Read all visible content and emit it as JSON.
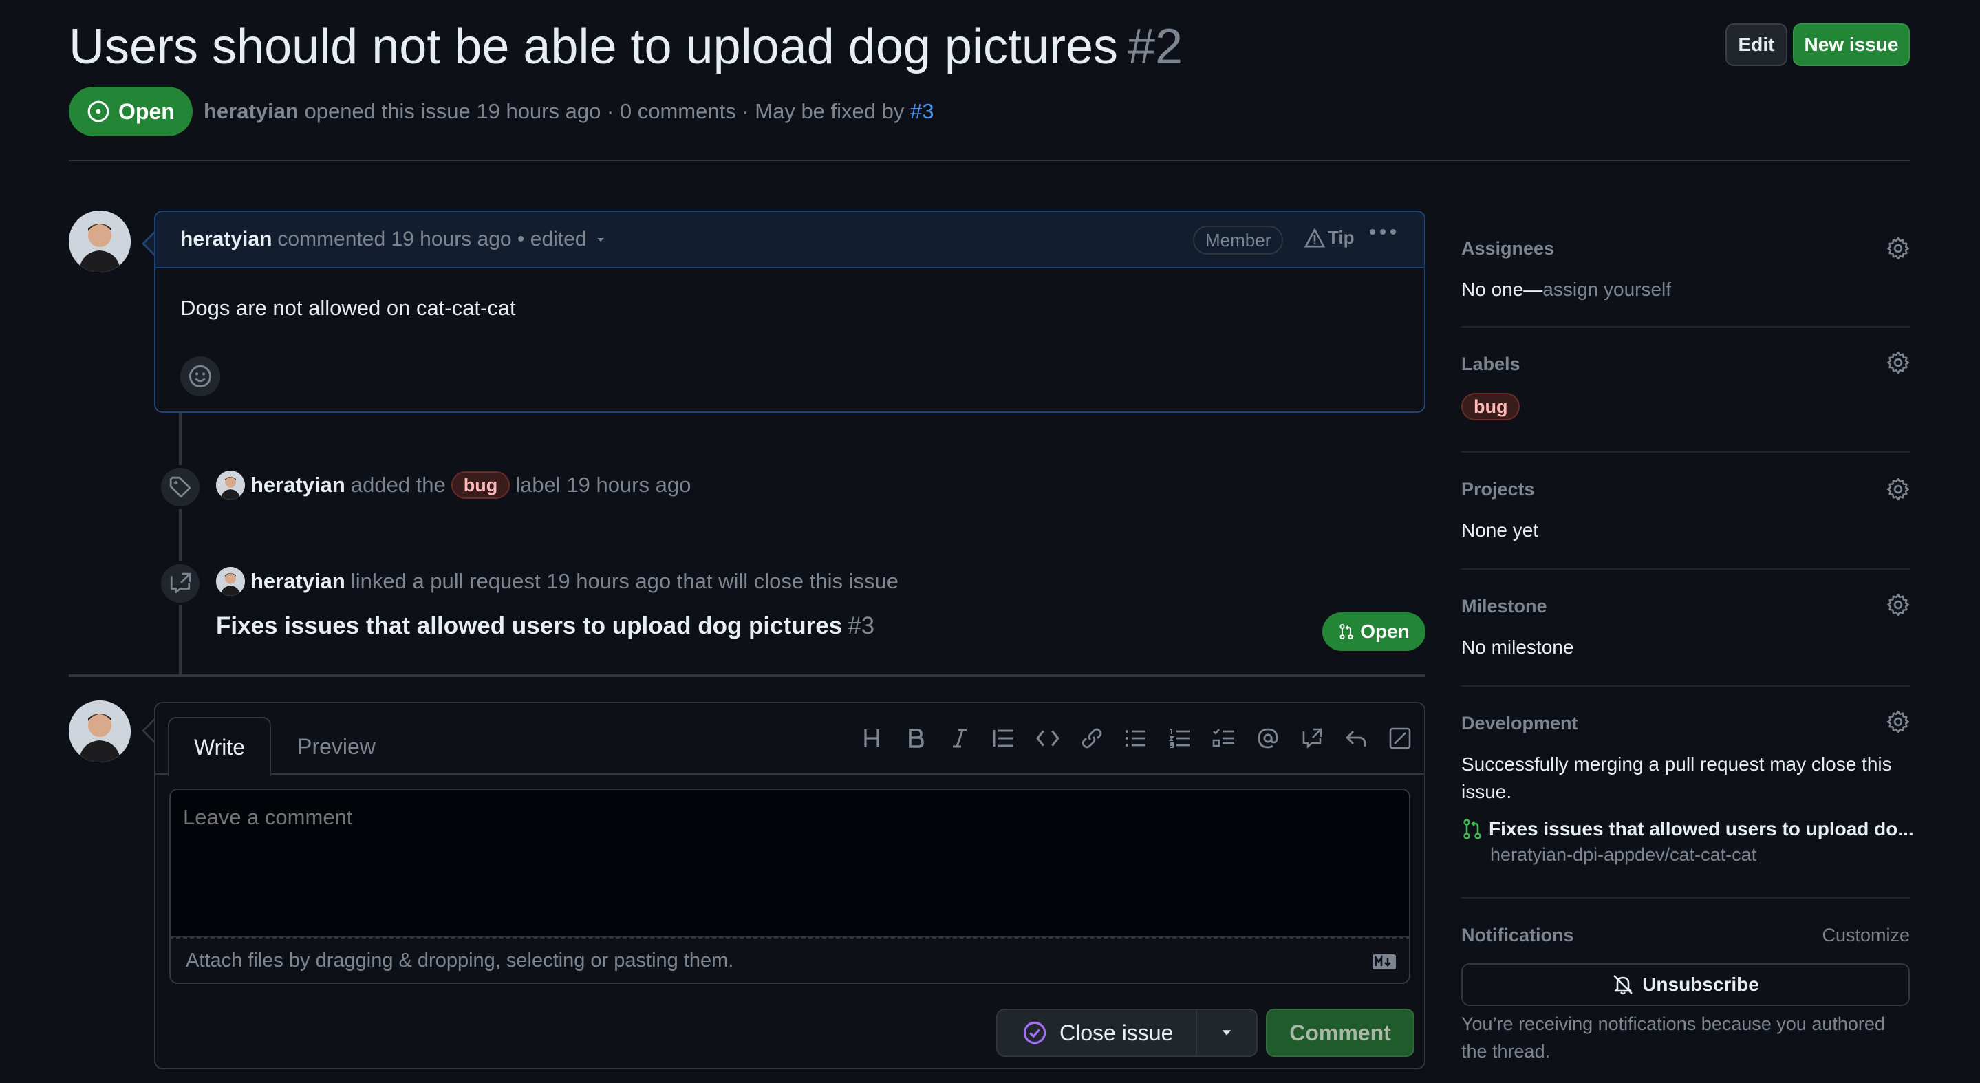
{
  "issue": {
    "title": "Users should not be able to upload dog pictures",
    "number": "#2",
    "state": "Open",
    "author": "heratyian",
    "opened_text": "opened this issue 19 hours ago · 0 comments · May be fixed by",
    "fixed_by": "#3"
  },
  "header": {
    "edit_label": "Edit",
    "new_issue_label": "New issue"
  },
  "comment": {
    "author": "heratyian",
    "meta": "commented 19 hours ago • edited",
    "badge": "Member",
    "tip": "Tip",
    "body": "Dogs are not allowed on cat-cat-cat"
  },
  "timeline": {
    "label_event": {
      "actor": "heratyian",
      "pre": "added the",
      "label": "bug",
      "post": "label 19 hours ago"
    },
    "link_event": {
      "actor": "heratyian",
      "text": "linked a pull request 19 hours ago that will close this issue",
      "pr_title": "Fixes issues that allowed users to upload dog pictures",
      "pr_number": "#3",
      "pr_state": "Open"
    }
  },
  "editor": {
    "tab_write": "Write",
    "tab_preview": "Preview",
    "placeholder": "Leave a comment",
    "attach_text": "Attach files by dragging & dropping, selecting or pasting them.",
    "close_label": "Close issue",
    "comment_label": "Comment"
  },
  "sidebar": {
    "assignees": {
      "title": "Assignees",
      "value": "No one—",
      "action": "assign yourself"
    },
    "labels": {
      "title": "Labels",
      "value": "bug"
    },
    "projects": {
      "title": "Projects",
      "value": "None yet"
    },
    "milestone": {
      "title": "Milestone",
      "value": "No milestone"
    },
    "development": {
      "title": "Development",
      "text": "Successfully merging a pull request may close this issue.",
      "pr_title": "Fixes issues that allowed users to upload do...",
      "repo": "heratyian-dpi-appdev/cat-cat-cat"
    },
    "notifications": {
      "title": "Notifications",
      "customize": "Customize",
      "button": "Unsubscribe",
      "note": "You’re receiving notifications because you authored the thread."
    }
  },
  "colors": {
    "open_green": "#238636",
    "link_blue": "#4493f8",
    "bug_label_bg": "#3a1c1d"
  }
}
